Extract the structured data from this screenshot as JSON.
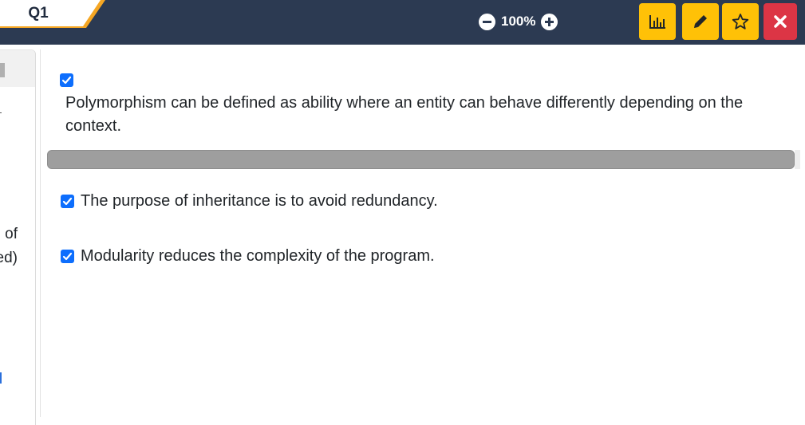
{
  "header": {
    "question_tab": "Q1",
    "zoom_level": "100%"
  },
  "toolbar": {
    "icons": [
      "chart-icon",
      "pencil-icon",
      "star-icon",
      "close-icon"
    ],
    "colors": {
      "bar": "#2c3a52",
      "accent": "#f5a623",
      "tool": "#ffc107",
      "close": "#dc3545"
    }
  },
  "sidebar": {
    "fragments": [
      "of",
      "ed)"
    ]
  },
  "question": {
    "text": "Polymorphism can be defined as ability where an entity can behave differently depending on the context.",
    "checked": true
  },
  "options": [
    {
      "label": "The purpose of inheritance is to avoid redundancy.",
      "checked": true
    },
    {
      "label": "Modularity reduces the complexity of the program.",
      "checked": true
    }
  ]
}
